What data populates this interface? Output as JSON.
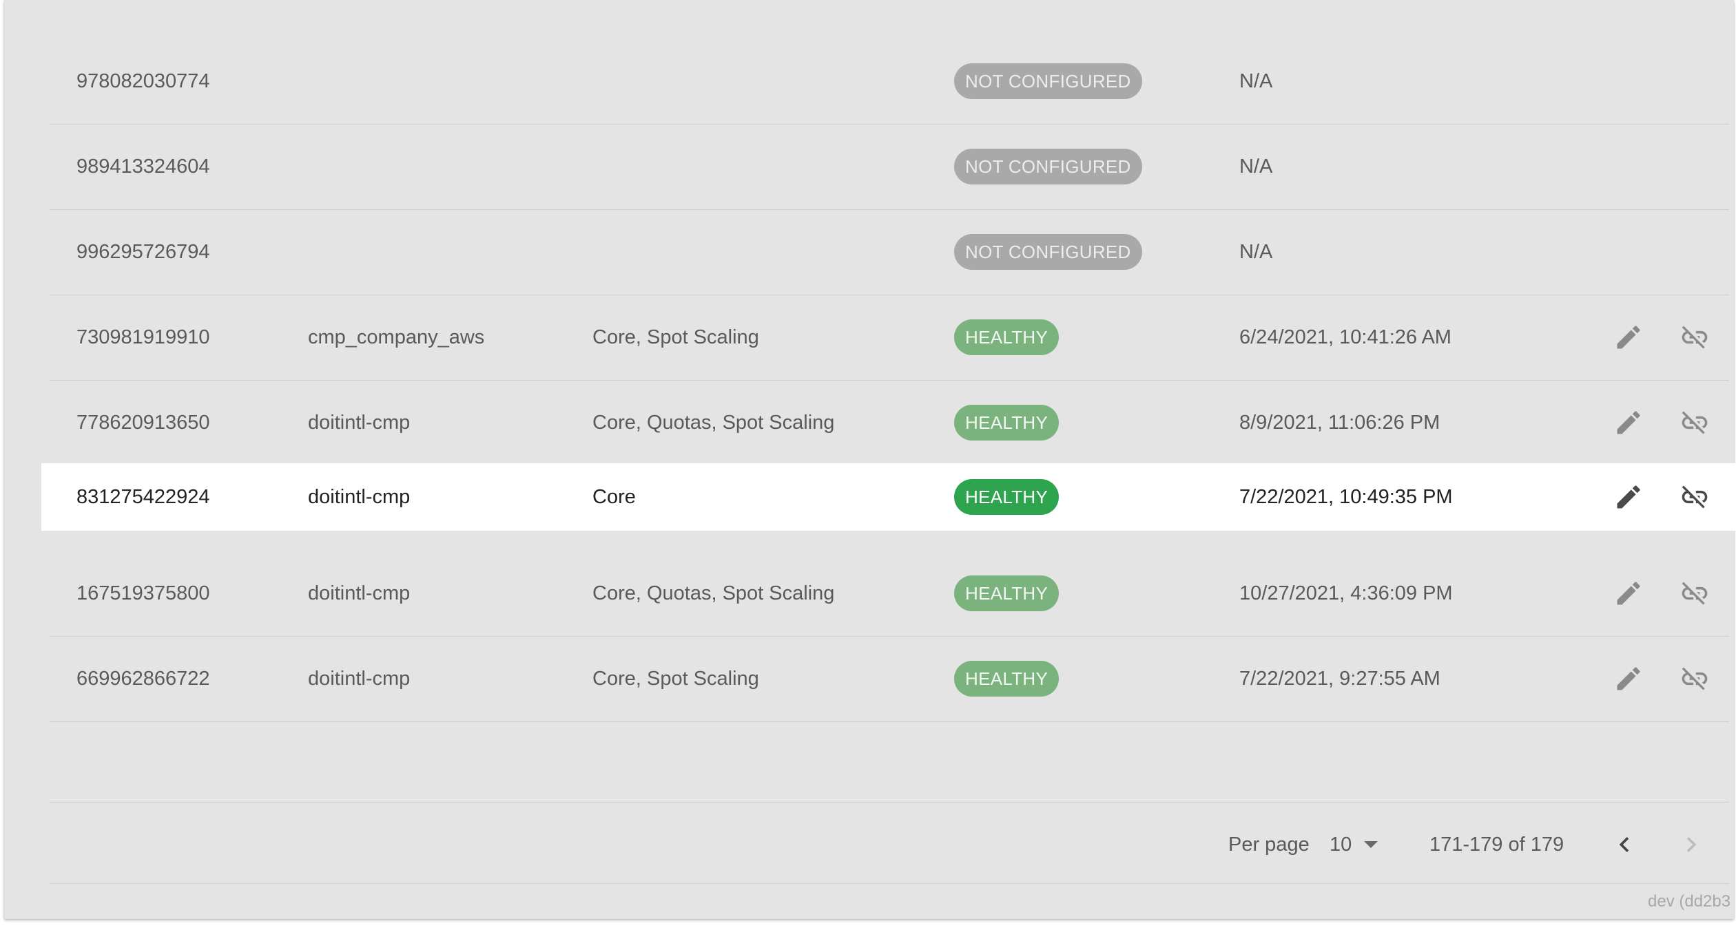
{
  "rows": [
    {
      "id": "978082030774",
      "alias": "",
      "features": "",
      "status": "NOT CONFIGURED",
      "status_kind": "gray",
      "last_updated": "N/A",
      "has_actions": false
    },
    {
      "id": "989413324604",
      "alias": "",
      "features": "",
      "status": "NOT CONFIGURED",
      "status_kind": "gray",
      "last_updated": "N/A",
      "has_actions": false
    },
    {
      "id": "996295726794",
      "alias": "",
      "features": "",
      "status": "NOT CONFIGURED",
      "status_kind": "gray",
      "last_updated": "N/A",
      "has_actions": false
    },
    {
      "id": "730981919910",
      "alias": "cmp_company_aws",
      "features": "Core, Spot Scaling",
      "status": "HEALTHY",
      "status_kind": "green",
      "last_updated": "6/24/2021, 10:41:26 AM",
      "has_actions": true
    },
    {
      "id": "778620913650",
      "alias": "doitintl-cmp",
      "features": "Core, Quotas, Spot Scaling",
      "status": "HEALTHY",
      "status_kind": "green",
      "last_updated": "8/9/2021, 11:06:26 PM",
      "has_actions": true
    },
    {
      "id": "831275422924",
      "alias": "doitintl-cmp",
      "features": "Core",
      "status": "HEALTHY",
      "status_kind": "green-strong",
      "last_updated": "7/22/2021, 10:49:35 PM",
      "has_actions": true,
      "selected": true
    },
    {
      "id": "167519375800",
      "alias": "doitintl-cmp",
      "features": "Core, Quotas, Spot Scaling",
      "status": "HEALTHY",
      "status_kind": "green",
      "last_updated": "10/27/2021, 4:36:09 PM",
      "has_actions": true
    },
    {
      "id": "669962866722",
      "alias": "doitintl-cmp",
      "features": "Core, Spot Scaling",
      "status": "HEALTHY",
      "status_kind": "green",
      "last_updated": "7/22/2021, 9:27:55 AM",
      "has_actions": true
    }
  ],
  "icons": {
    "edit": "pencil-icon",
    "unlink": "link-off-icon",
    "prev": "chevron-left-icon",
    "next": "chevron-right-icon",
    "dropdown": "arrow-drop-down-icon"
  },
  "pagination": {
    "per_page_label": "Per page",
    "per_page_value": "10",
    "range_text": "171-179 of 179"
  },
  "version_text": "dev (dd2b3",
  "colors": {
    "card_bg": "#e4e4e4",
    "selected_row_bg": "#ffffff",
    "badge_gray": "#a9a9a9",
    "badge_green": "#7bb37e",
    "badge_green_strong": "#2ea44f"
  }
}
